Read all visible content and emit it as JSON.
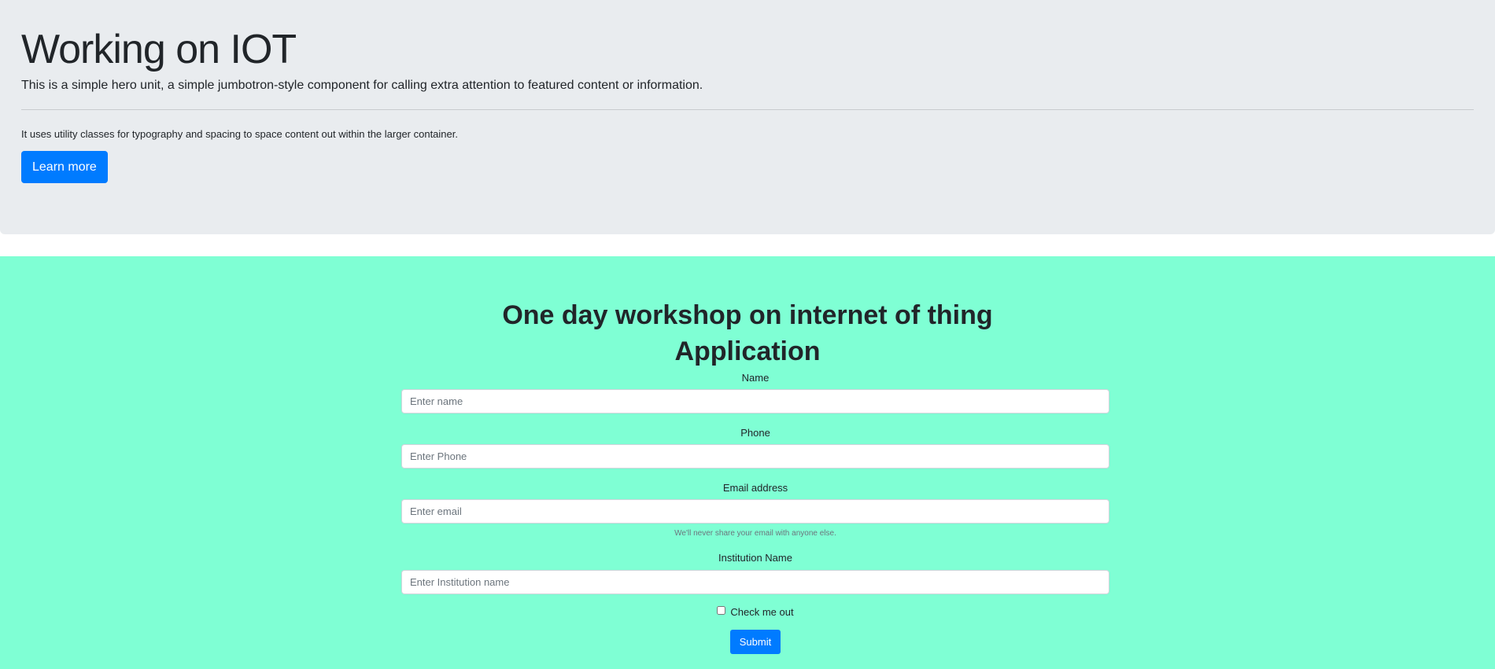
{
  "hero": {
    "title": "Working on IOT",
    "lead": "This is a simple hero unit, a simple jumbotron-style component for calling extra attention to featured content or information.",
    "text": "It uses utility classes for typography and spacing to space content out within the larger container.",
    "button_label": "Learn more"
  },
  "workshop": {
    "title": "One day workshop on internet of thing Application",
    "background_color": "#7fffd4"
  },
  "form": {
    "name_label": "Name",
    "name_placeholder": "Enter name",
    "phone_label": "Phone",
    "phone_placeholder": "Enter Phone",
    "email_label": "Email address",
    "email_placeholder": "Enter email",
    "email_help": "We'll never share your email with anyone else.",
    "institution_label": "Institution Name",
    "institution_placeholder": "Enter Institution name",
    "checkbox_label": "Check me out",
    "checkbox_checked": false,
    "submit_label": "Submit"
  },
  "colors": {
    "primary": "#007bff",
    "jumbotron_bg": "#e9ecef"
  }
}
